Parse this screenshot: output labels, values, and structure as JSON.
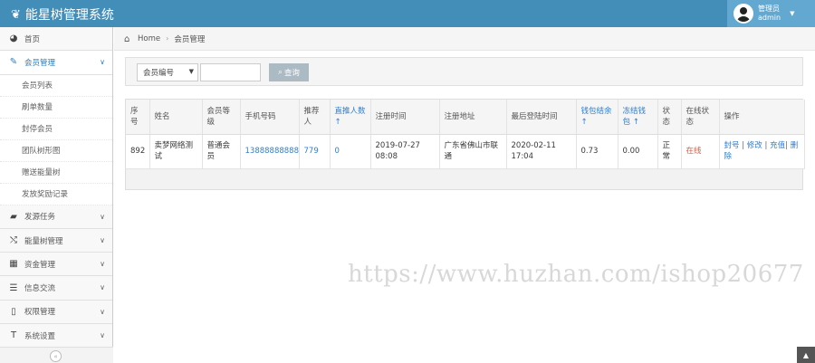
{
  "header": {
    "brand": "能星树管理系统",
    "brand_icon": "leaf-icon",
    "user_role": "管理员",
    "user_name": "admin",
    "colors": {
      "navbar": "#438eb9",
      "user_box": "#62a8d1"
    }
  },
  "sidebar": {
    "items": [
      {
        "label": "首页",
        "icon": "dashboard-icon"
      },
      {
        "label": "会员管理",
        "icon": "edit-icon",
        "active": true
      },
      {
        "label": "发源任务",
        "icon": "book-icon"
      },
      {
        "label": "能量树管理",
        "icon": "shuffle-icon"
      },
      {
        "label": "资金管理",
        "icon": "calendar-icon"
      },
      {
        "label": "信息交流",
        "icon": "list-icon"
      },
      {
        "label": "权限管理",
        "icon": "file-icon"
      },
      {
        "label": "系统设置",
        "icon": "text-icon"
      }
    ],
    "subitems": [
      "会员列表",
      "刷单数量",
      "封停会员",
      "团队树形图",
      "赠送能量树",
      "发放奖励记录"
    ],
    "collapse_icon": "«"
  },
  "breadcrumb": {
    "home": "Home",
    "current": "会员管理"
  },
  "search": {
    "select_value": "会员编号",
    "input_value": "",
    "button_label": "查询"
  },
  "table": {
    "headers": [
      "序号",
      "姓名",
      "会员等级",
      "手机号码",
      "推荐人",
      "直推人数 ↑",
      "注册时间",
      "注册地址",
      "最后登陆时间",
      "钱包结余 ↑",
      "冻结钱包 ↑",
      "状态",
      "在线状态",
      "操作"
    ],
    "rows": [
      {
        "id": "892",
        "name": "卖梦网络测试",
        "level": "普通会员",
        "phone": "13888888888",
        "referrer": "779",
        "direct_count": "0",
        "reg_time": "2019-07-27 08:08",
        "reg_address": "广东省佛山市联通",
        "last_login": "2020-02-11 17:04",
        "wallet": "0.73",
        "frozen": "0.00",
        "status": "正常",
        "online": "在线",
        "actions": [
          "封号",
          "修改",
          "充值",
          "删除"
        ]
      }
    ]
  },
  "watermark": "https://www.huzhan.com/ishop20677",
  "to_top_icon": "▲"
}
